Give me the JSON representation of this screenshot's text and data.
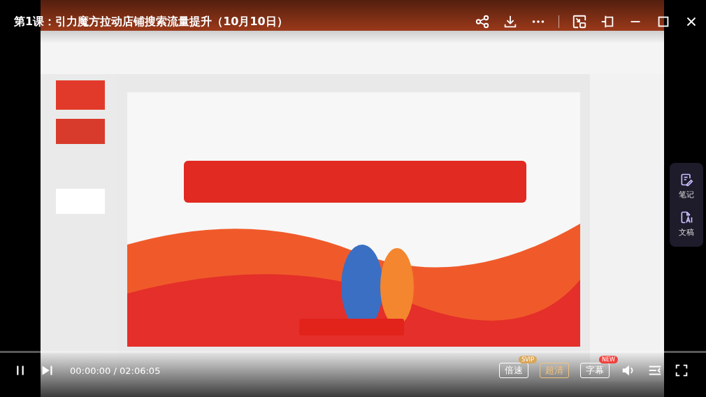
{
  "title": "第1课：引力魔方拉动店铺搜索流量提升（10月10日）",
  "player": {
    "playing": true,
    "time": "00:00:00 / 02:06:05",
    "progress": {
      "level": 0
    }
  },
  "options": [
    {
      "label": "倍速",
      "selected": false,
      "badge": {
        "text": "SVIP",
        "color": "#d9a75a"
      }
    },
    {
      "label": "超清",
      "selected": true
    },
    {
      "label": "字幕",
      "selected": false,
      "badge": {
        "text": "NEW",
        "color": "#f0413c"
      }
    }
  ],
  "side_panel": [
    {
      "kind": "note",
      "label": "笔记"
    },
    {
      "kind": "script",
      "label": "文稿"
    }
  ]
}
